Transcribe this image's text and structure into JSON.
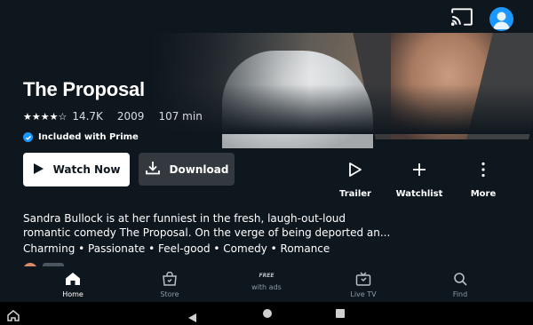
{
  "movie": {
    "title": "The Proposal",
    "rating_stars": "★★★★☆",
    "rating_value": 4.5,
    "review_count": "14.7K",
    "year": "2009",
    "runtime": "107 min",
    "prime_label": "Included with Prime",
    "synopsis": "Sandra Bullock is at her funniest in the fresh, laugh-out-loud romantic comedy The Proposal. On the verge of being deported an...",
    "tags": "Charming • Passionate • Feel-good • Comedy • Romance"
  },
  "buttons": {
    "watch_now": "Watch Now",
    "download": "Download"
  },
  "actions": [
    {
      "label": "Trailer",
      "icon": "play-outline-icon"
    },
    {
      "label": "Watchlist",
      "icon": "plus-icon"
    },
    {
      "label": "More",
      "icon": "more-vertical-icon"
    }
  ],
  "nav": [
    {
      "label": "Home",
      "icon": "home-icon",
      "active": true
    },
    {
      "label": "Store",
      "icon": "store-icon",
      "active": false
    },
    {
      "label": "with ads",
      "badge": "FREE",
      "icon": "free-with-ads-icon",
      "active": false
    },
    {
      "label": "Live TV",
      "icon": "live-tv-icon",
      "active": false
    },
    {
      "label": "Find",
      "icon": "search-icon",
      "active": false
    }
  ],
  "colors": {
    "background": "#0f171e",
    "accent": "#1a98ff",
    "secondary_button": "#33393f"
  }
}
